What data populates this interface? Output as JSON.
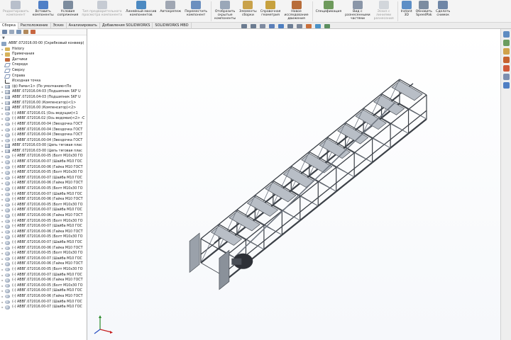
{
  "ribbon": {
    "buttons": [
      {
        "label": "Редактировать\nкомпонент",
        "icon": "edit-component-icon",
        "color": "#6e7f99",
        "enabled": false
      },
      {
        "label": "Вставить\nкомпоненты",
        "icon": "insert-components-icon",
        "color": "#4f7fc7",
        "enabled": true
      },
      {
        "label": "Условия\nсопряжения",
        "icon": "mate-icon",
        "color": "#7d8c9e",
        "enabled": true
      },
      {
        "label": "Тип предварительного\nпросмотра компонента",
        "icon": "component-preview-icon",
        "color": "#8d99aa",
        "enabled": false
      },
      {
        "label": "Линейный массив\nкомпонентов",
        "icon": "linear-pattern-icon",
        "color": "#4d8ac2",
        "enabled": true
      },
      {
        "label": "Автокрепеж",
        "icon": "smart-fasteners-icon",
        "color": "#a0a7b3",
        "enabled": true
      },
      {
        "label": "Переместить\nкомпонент",
        "icon": "move-component-icon",
        "color": "#6b8fbf",
        "enabled": true
      },
      {
        "label": "Отобразить\nскрытые\nкомпоненты",
        "icon": "show-hidden-icon",
        "color": "#9aa7b8",
        "enabled": true
      },
      {
        "label": "Элементы\nсборки",
        "icon": "assembly-features-icon",
        "color": "#c9a24a",
        "enabled": true
      },
      {
        "label": "Справочная\nгеометрия",
        "icon": "reference-geometry-icon",
        "color": "#c7a13e",
        "enabled": true
      },
      {
        "label": "Новое\nисследование\nдвижения",
        "icon": "motion-study-icon",
        "color": "#b86d3a",
        "enabled": true
      },
      {
        "label": "Спецификация",
        "icon": "bom-icon",
        "color": "#6e9a5c",
        "enabled": true
      },
      {
        "label": "Вид с\nразнесенными\nчастями",
        "icon": "exploded-view-icon",
        "color": "#8a96a8",
        "enabled": true
      },
      {
        "label": "Эскиз с\nлиниями\nразнесения",
        "icon": "explode-line-sketch-icon",
        "color": "#a9b1bd",
        "enabled": false
      },
      {
        "label": "Instant\n3D",
        "icon": "instant-3d-icon",
        "color": "#5c8ec6",
        "enabled": true
      },
      {
        "label": "Обновить\nSpeedPak",
        "icon": "speedpak-icon",
        "color": "#7c8ca0",
        "enabled": true
      },
      {
        "label": "Сделать\nснимок",
        "icon": "snapshot-icon",
        "color": "#6f86a6",
        "enabled": true
      }
    ]
  },
  "tabs": [
    {
      "label": "Сборка",
      "active": true
    },
    {
      "label": "Расположение",
      "active": false
    },
    {
      "label": "Эскиз",
      "active": false
    },
    {
      "label": "Анализировать",
      "active": false
    },
    {
      "label": "Добавления SOLIDWORKS",
      "active": false
    },
    {
      "label": "SOLIDWORKS MBD",
      "active": false
    }
  ],
  "tree": {
    "filter_symbol": "▼",
    "root": "АВВГ.072016.00-00 (Скребковый конвеер)",
    "items": [
      {
        "label": "History",
        "icon": "folder",
        "exp": "▸"
      },
      {
        "label": "Примечания",
        "icon": "folder",
        "exp": "▸"
      },
      {
        "label": "Датчики",
        "icon": "sensor",
        "exp": ""
      },
      {
        "label": "Спереди",
        "icon": "plane",
        "exp": ""
      },
      {
        "label": "Сверху",
        "icon": "plane",
        "exp": ""
      },
      {
        "label": "Справа",
        "icon": "plane",
        "exp": ""
      },
      {
        "label": "Исходная точка",
        "icon": "origin",
        "exp": ""
      },
      {
        "label": "(ф) Рама<1> (По умолчанию<По",
        "icon": "asm",
        "exp": "▸"
      },
      {
        "label": "АВВГ.072016.04-03 (Подшипник SKF U",
        "icon": "asm",
        "exp": "▸"
      },
      {
        "label": "АВВГ.072016.04-03 (Подшипник SKF U",
        "icon": "asm",
        "exp": "▸"
      },
      {
        "label": "АВВГ.072016.00 (Компенсатор)<1>",
        "icon": "asm",
        "exp": "▸"
      },
      {
        "label": "АВВГ.072016.00 (Компенсатор)<2>",
        "icon": "asm",
        "exp": "▸"
      },
      {
        "label": "(-) АВВГ.072016.01 (Ось ведущая)<1",
        "icon": "part",
        "exp": "▸"
      },
      {
        "label": "(-) АВВГ.072016.02 (Ось ведомая)<2> -С",
        "icon": "part",
        "exp": "▸"
      },
      {
        "label": "(-) АВВГ.072016.00-04 (Звездочка ГОСТ",
        "icon": "part",
        "exp": "▸"
      },
      {
        "label": "(-) АВВГ.072016.00-04 (Звездочка ГОСТ",
        "icon": "part",
        "exp": "▸"
      },
      {
        "label": "(-) АВВГ.072016.00-04 (Звездочка ГОСТ",
        "icon": "part",
        "exp": "▸"
      },
      {
        "label": "(-) АВВГ.072016.00-04 (Звездочка ГОСТ",
        "icon": "part",
        "exp": "▸"
      },
      {
        "label": "АВВГ.072016.03-00 (Цепь тяговая плас",
        "icon": "asm",
        "exp": "▸"
      },
      {
        "label": "АВВГ.072016.03-00 (Цепь тяговая плас",
        "icon": "asm",
        "exp": "▸"
      },
      {
        "label": "(-) АВВГ.072016.00-05 (Болт М10х30 ГО",
        "icon": "part",
        "exp": "▸"
      },
      {
        "label": "(-) АВВГ.072016.00-07 (Шайба М10 ГОС",
        "icon": "part",
        "exp": "▸"
      },
      {
        "label": "(-) АВВГ.072016.00-06 (Гайка М10 ГОСТ",
        "icon": "part",
        "exp": "▸"
      },
      {
        "label": "(-) АВВГ.072016.00-05 (Болт М10х30 ГО",
        "icon": "part",
        "exp": "▸"
      },
      {
        "label": "(-) АВВГ.072016.00-07 (Шайба М10 ГОС",
        "icon": "part",
        "exp": "▸"
      },
      {
        "label": "(-) АВВГ.072016.00-06 (Гайка М10 ГОСТ",
        "icon": "part",
        "exp": "▸"
      },
      {
        "label": "(-) АВВГ.072016.00-05 (Болт М10х30 ГО",
        "icon": "part",
        "exp": "▸"
      },
      {
        "label": "(-) АВВГ.072016.00-07 (Шайба М10 ГОС",
        "icon": "part",
        "exp": "▸"
      },
      {
        "label": "(-) АВВГ.072016.00-06 (Гайка М10 ГОСТ",
        "icon": "part",
        "exp": "▸"
      },
      {
        "label": "(-) АВВГ.072016.00-05 (Болт М10х30 ГО",
        "icon": "part",
        "exp": "▸"
      },
      {
        "label": "(-) АВВГ.072016.00-07 (Шайба М10 ГОС",
        "icon": "part",
        "exp": "▸"
      },
      {
        "label": "(-) АВВГ.072016.00-06 (Гайка М10 ГОСТ",
        "icon": "part",
        "exp": "▸"
      },
      {
        "label": "(-) АВВГ.072016.00-05 (Болт М10х30 ГО",
        "icon": "part",
        "exp": "▸"
      },
      {
        "label": "(-) АВВГ.072016.00-07 (Шайба М10 ГОС",
        "icon": "part",
        "exp": "▸"
      },
      {
        "label": "(-) АВВГ.072016.00-06 (Гайка М10 ГОСТ",
        "icon": "part",
        "exp": "▸"
      },
      {
        "label": "(-) АВВГ.072016.00-05 (Болт М10х30 ГО",
        "icon": "part",
        "exp": "▸"
      },
      {
        "label": "(-) АВВГ.072016.00-07 (Шайба М10 ГОС",
        "icon": "part",
        "exp": "▸"
      },
      {
        "label": "(-) АВВГ.072016.00-06 (Гайка М10 ГОСТ",
        "icon": "part",
        "exp": "▸"
      },
      {
        "label": "(-) АВВГ.072016.00-05 (Болт М10х30 ГО",
        "icon": "part",
        "exp": "▸"
      },
      {
        "label": "(-) АВВГ.072016.00-07 (Шайба М10 ГОС",
        "icon": "part",
        "exp": "▸"
      },
      {
        "label": "(-) АВВГ.072016.00-06 (Гайка М10 ГОСТ",
        "icon": "part",
        "exp": "▸"
      },
      {
        "label": "(-) АВВГ.072016.00-05 (Болт М10х30 ГО",
        "icon": "part",
        "exp": "▸"
      },
      {
        "label": "(-) АВВГ.072016.00-07 (Шайба М10 ГОС",
        "icon": "part",
        "exp": "▸"
      },
      {
        "label": "(-) АВВГ.072016.00-06 (Гайка М10 ГОСТ",
        "icon": "part",
        "exp": "▸"
      },
      {
        "label": "(-) АВВГ.072016.00-05 (Болт М10х30 ГО",
        "icon": "part",
        "exp": "▸"
      },
      {
        "label": "(-) АВВГ.072016.00-07 (Шайба М10 ГОС",
        "icon": "part",
        "exp": "▸"
      },
      {
        "label": "(-) АВВГ.072016.00-06 (Гайка М10 ГОСТ",
        "icon": "part",
        "exp": "▸"
      },
      {
        "label": "(-) АВВГ.072016.00-07 (Шайба М10 ГОС",
        "icon": "part",
        "exp": "▸"
      },
      {
        "label": "(-) АВВГ.072016.00-07 (Шайба М10 ГОС",
        "icon": "part",
        "exp": "▸"
      }
    ]
  },
  "view_toolbar": [
    {
      "icon": "zoom-to-fit-icon",
      "color": "#6b7b90"
    },
    {
      "icon": "zoom-area-icon",
      "color": "#6b7b90"
    },
    {
      "icon": "previous-view-icon",
      "color": "#7d8aa0"
    },
    {
      "icon": "section-view-icon",
      "color": "#5b7fb8"
    },
    {
      "icon": "view-orientation-icon",
      "color": "#4d7ec0"
    },
    {
      "icon": "display-style-icon",
      "color": "#6d7e95"
    },
    {
      "icon": "hide-show-icon",
      "color": "#7c8799"
    },
    {
      "icon": "appearance-icon",
      "color": "#c96f3b"
    },
    {
      "icon": "scene-icon",
      "color": "#4a92c7"
    },
    {
      "icon": "view-settings-icon",
      "color": "#5c8f5f"
    }
  ],
  "task_pane": [
    {
      "icon": "home-icon",
      "color": "#5d8bc1"
    },
    {
      "icon": "design-library-icon",
      "color": "#6a9c5f"
    },
    {
      "icon": "file-explorer-icon",
      "color": "#d0a24a"
    },
    {
      "icon": "view-palette-icon",
      "color": "#c6622f"
    },
    {
      "icon": "appearances-icon",
      "color": "#d05a3a"
    },
    {
      "icon": "custom-properties-icon",
      "color": "#7c8fb0"
    },
    {
      "icon": "forum-icon",
      "color": "#4f7fc3"
    }
  ],
  "colors": {
    "model_steel": "#6f7680",
    "model_dark": "#3b4047",
    "motor": "#2e3137"
  }
}
